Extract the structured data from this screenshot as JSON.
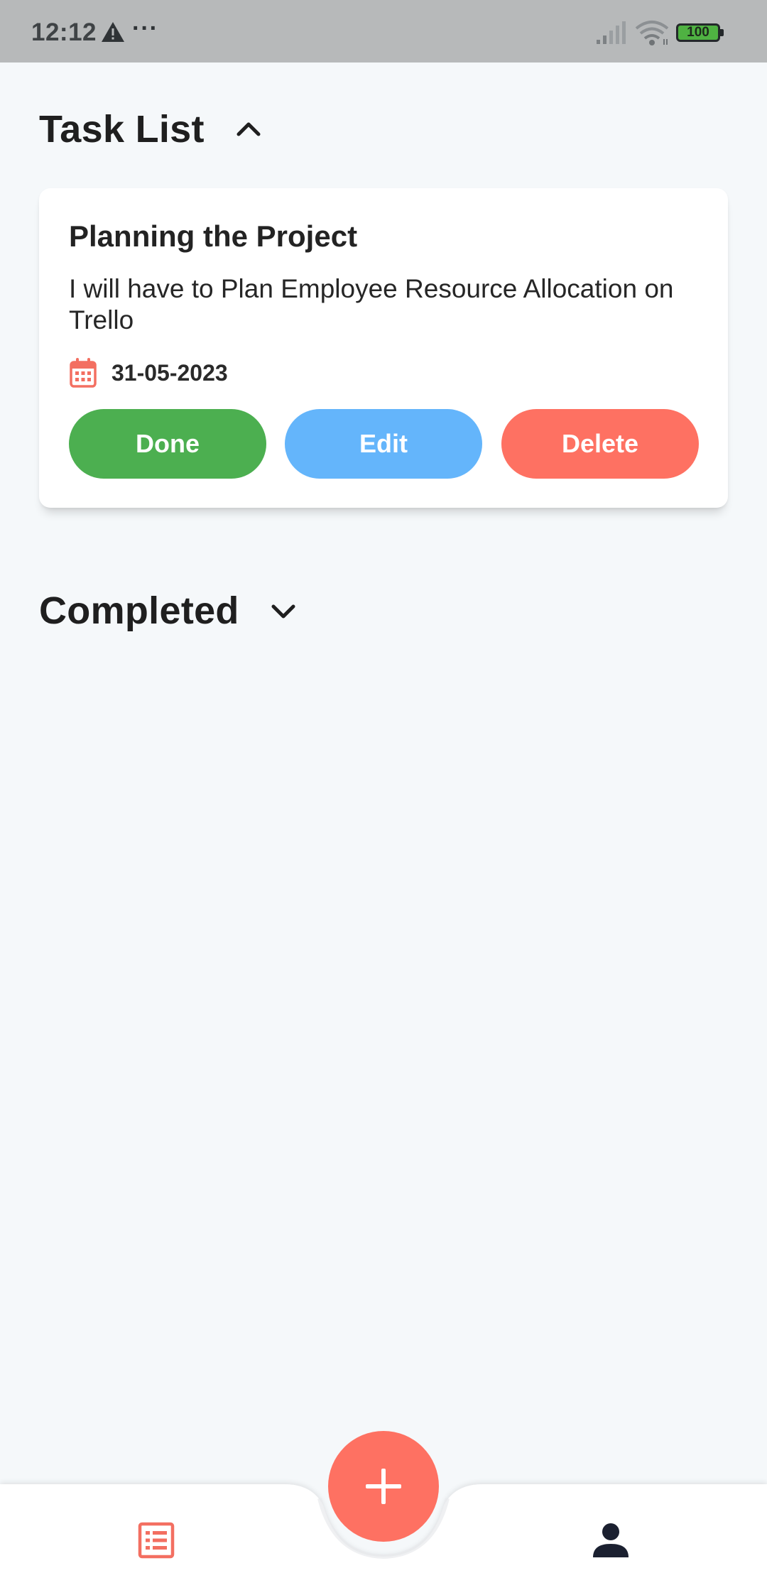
{
  "status_bar": {
    "time": "12:12",
    "dots": "···",
    "battery": "100",
    "icons": [
      "warning-icon",
      "signal-icon",
      "wifi-icon",
      "battery-icon"
    ]
  },
  "task_list": {
    "title": "Task List",
    "expanded": true,
    "chevron": "chevron-up-icon",
    "tasks": [
      {
        "title": "Planning the Project",
        "description": "I will have to Plan Employee Resource Allocation on Trello",
        "date": "31-05-2023",
        "date_icon": "calendar-icon",
        "actions": {
          "done": "Done",
          "edit": "Edit",
          "delete": "Delete"
        }
      }
    ]
  },
  "completed": {
    "title": "Completed",
    "expanded": false,
    "chevron": "chevron-down-icon"
  },
  "bottom_nav": {
    "fab_icon": "plus-icon",
    "left_icon": "task-list-icon",
    "right_icon": "person-icon"
  },
  "colors": {
    "accent": "#fe7162",
    "done": "#4caf50",
    "edit": "#64b5fb",
    "delete": "#fe7162",
    "background": "#f5f8fa",
    "status_bar": "#b7b9ba"
  }
}
